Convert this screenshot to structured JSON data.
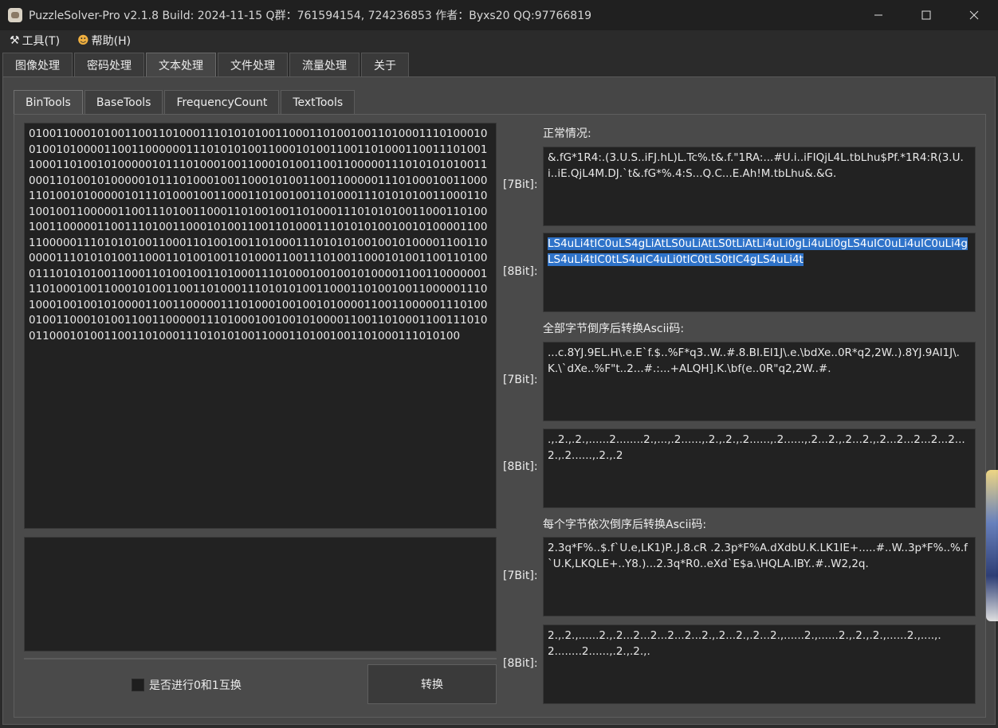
{
  "window": {
    "title": "PuzzleSolver-Pro v2.1.8  Build: 2024-11-15  Q群：761594154, 724236853  作者：Byxs20  QQ:97766819"
  },
  "menu": {
    "tools": "工具(T)",
    "help": "帮助(H)"
  },
  "top_tabs": [
    "图像处理",
    "密码处理",
    "文本处理",
    "文件处理",
    "流量处理",
    "关于"
  ],
  "sub_tabs": [
    "BinTools",
    "BaseTools",
    "FrequencyCount",
    "TextTools"
  ],
  "binary_input": "0100110001010011001101000111010101001100011010010011010001110100010010010100001100110000001110101010011000101001100110100011001110100110001101001010000010111010001001100010100110011000001110101010100110001101001010000010111010001001100010100110011000001110100010011000110100101000001011101000100110001101001001101000111010101001100011010010011000001100111010011000110100100110100011101010100110001101001001100000110011101001100010100110011010001110101010010010100001100110000011101010100110001101001001101000111010101001001010000110011000001110101010011000110100100110100011001110100110001010011001101000111010101001100011010010011010001110100010010010100001100110000001110100010011000101001100110100011101010100110001101001001100000111010001001001010000110011000001110100010010010100001100110000011101000100110001010011001100000111010001001001010000110011010001100111010011000101001100110100011101010100110001101001001101000111010100",
  "checkbox_label": "是否进行0和1互换",
  "convert_button": "转换",
  "labels": {
    "normal": "正常情况:",
    "reverse_all": "全部字节倒序后转换Ascii码:",
    "reverse_each": "每个字节依次倒序后转换Ascii码:",
    "bit7": "[7Bit]:",
    "bit8": "[8Bit]:"
  },
  "outputs": {
    "normal_7bit": "&.fG*1R4:.(3.U.S..iFJ.hL)L.Tc%.t&.f.\"1RA:...#U.i..iFIQjL4L.tbLhu$Pf.*1R4:R(3.U.i..iE.QjL4M.DJ.`t&.fG*%.4:S...Q.C...E.Ah!M.tbLhu&.&G.",
    "normal_8bit": "LS4uLi4tIC0uLS4gLiAtLS0uLiAtLS0tLiAtLi4uLi0gLi4uLi0gLS4uIC0uLi4uIC0uLi4gLS4uLi4tIC0tLS4uIC4uLi0tIC0tLS0tIC4gLS4uLi4t",
    "reverse_all_7bit": "...c.8YJ.9EL.H\\.e.E`f.$..%F*q3..W..#.8.BI.EI1J\\.e.\\bdXe..0R*q2,2W..).8YJ.9AI1J\\.K.\\`dXe..%F\"t..2...#.:...+ALQH].K.\\bf(e..0R\"q2,2W..#.",
    "reverse_all_8bit": ".,.2.,.2.,......2........2.,...,.2......,.2.,.2.,.2......,.2......,.2...2.,.2...2.,.2...2...2...2...2...2.,.2......,.2.,.2",
    "reverse_each_7bit": "2.3q*F%..$.f`U.e,LK1)P..J.8.cR .2.3p*F%A.dXdbU.K.LK1IE+.....#..W..3p*F%..%.f`U.K,LKQLE+..Y8.)...2.3q*R0..eXd`E$a.\\HQLA.IBY..#..W2,2q.",
    "reverse_each_8bit": "2.,.2.,......2.,.2...2...2...2...2...2.,.2...2.,.2...2.,......2.,......2.,.2.,.2.,......2.,....,.2........2......,.2.,.2.,."
  }
}
